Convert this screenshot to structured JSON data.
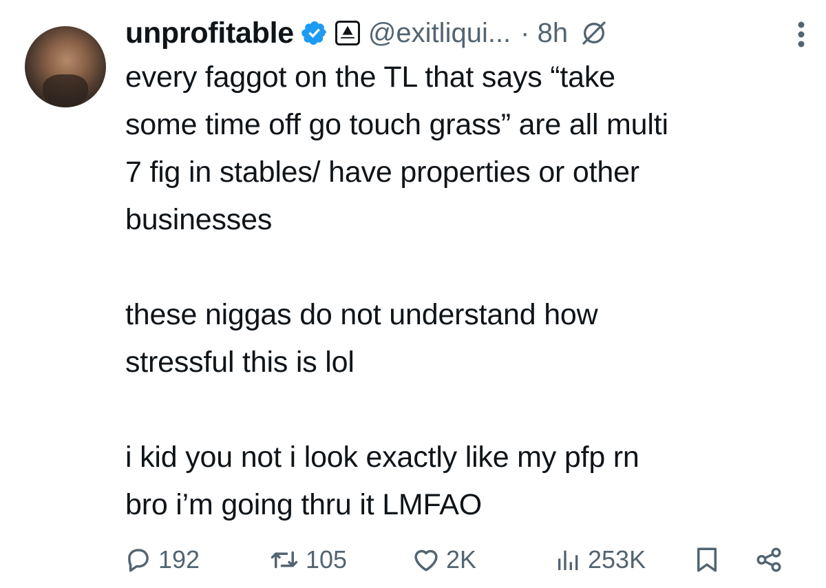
{
  "author": {
    "display_name": "unprofitable",
    "handle": "@exitliqui...",
    "time": "· 8h",
    "icons": [
      "verified-badge-icon",
      "affiliate-badge-icon",
      "grok-icon",
      "more-options-icon"
    ],
    "accent": "#1d9bf0"
  },
  "tweet": {
    "paragraphs": [
      [
        "every faggot on the TL that says “take",
        "some time off go touch grass” are all multi",
        "7 fig in stables/ have properties or other",
        "businesses"
      ],
      [
        "these niggas do not understand how",
        "stressful this is lol"
      ],
      [
        "i kid you not i look exactly like my pfp rn",
        "bro i’m going thru it LMFAO"
      ]
    ]
  },
  "metrics": {
    "replies": "192",
    "reposts": "105",
    "likes": "2K",
    "views": "253K"
  },
  "colors": {
    "text": "#0f1419",
    "secondary": "#536471",
    "verified": "#1d9bf0"
  }
}
